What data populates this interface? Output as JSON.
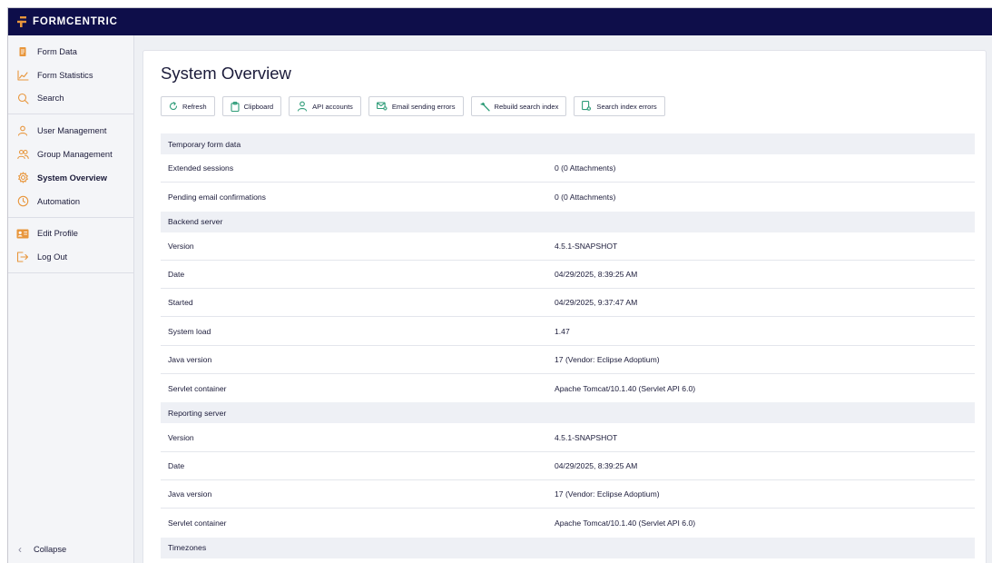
{
  "app": {
    "brand": "FORMCENTRIC"
  },
  "sidebar": {
    "groups": [
      [
        {
          "label": "Form Data",
          "icon": "document-icon"
        },
        {
          "label": "Form Statistics",
          "icon": "chart-line-icon"
        },
        {
          "label": "Search",
          "icon": "search-icon"
        }
      ],
      [
        {
          "label": "User Management",
          "icon": "user-icon"
        },
        {
          "label": "Group Management",
          "icon": "users-icon"
        },
        {
          "label": "System Overview",
          "icon": "gear-icon",
          "active": true
        },
        {
          "label": "Automation",
          "icon": "clock-icon"
        }
      ],
      [
        {
          "label": "Edit Profile",
          "icon": "id-card-icon"
        },
        {
          "label": "Log Out",
          "icon": "logout-icon"
        }
      ]
    ],
    "collapse_label": "Collapse"
  },
  "page": {
    "title": "System Overview",
    "toolbar": [
      {
        "label": "Refresh",
        "icon": "refresh-icon"
      },
      {
        "label": "Clipboard",
        "icon": "clipboard-icon"
      },
      {
        "label": "API accounts",
        "icon": "user-icon"
      },
      {
        "label": "Email sending errors",
        "icon": "email-error-icon"
      },
      {
        "label": "Rebuild search index",
        "icon": "hammer-icon"
      },
      {
        "label": "Search index errors",
        "icon": "search-error-icon"
      }
    ]
  },
  "sections": [
    {
      "title": "Temporary form data",
      "rows": [
        {
          "key": "Extended sessions",
          "value": "0 (0 Attachments)"
        },
        {
          "key": "Pending email confirmations",
          "value": "0 (0 Attachments)"
        }
      ]
    },
    {
      "title": "Backend server",
      "rows": [
        {
          "key": "Version",
          "value": "4.5.1-SNAPSHOT"
        },
        {
          "key": "Date",
          "value": "04/29/2025, 8:39:25 AM"
        },
        {
          "key": "Started",
          "value": "04/29/2025, 9:37:47 AM"
        },
        {
          "key": "System load",
          "value": "1.47"
        },
        {
          "key": "Java version",
          "value": "17 (Vendor: Eclipse Adoptium)"
        },
        {
          "key": "Servlet container",
          "value": "Apache Tomcat/10.1.40 (Servlet API 6.0)"
        }
      ]
    },
    {
      "title": "Reporting server",
      "rows": [
        {
          "key": "Version",
          "value": "4.5.1-SNAPSHOT"
        },
        {
          "key": "Date",
          "value": "04/29/2025, 8:39:25 AM"
        },
        {
          "key": "Java version",
          "value": "17 (Vendor: Eclipse Adoptium)"
        },
        {
          "key": "Servlet container",
          "value": "Apache Tomcat/10.1.40 (Servlet API 6.0)"
        }
      ]
    },
    {
      "title": "Timezones",
      "rows": []
    }
  ],
  "colors": {
    "topbar": "#0e0e4a",
    "icon_accent": "#e8963c",
    "button_icon": "#2e9c78"
  }
}
